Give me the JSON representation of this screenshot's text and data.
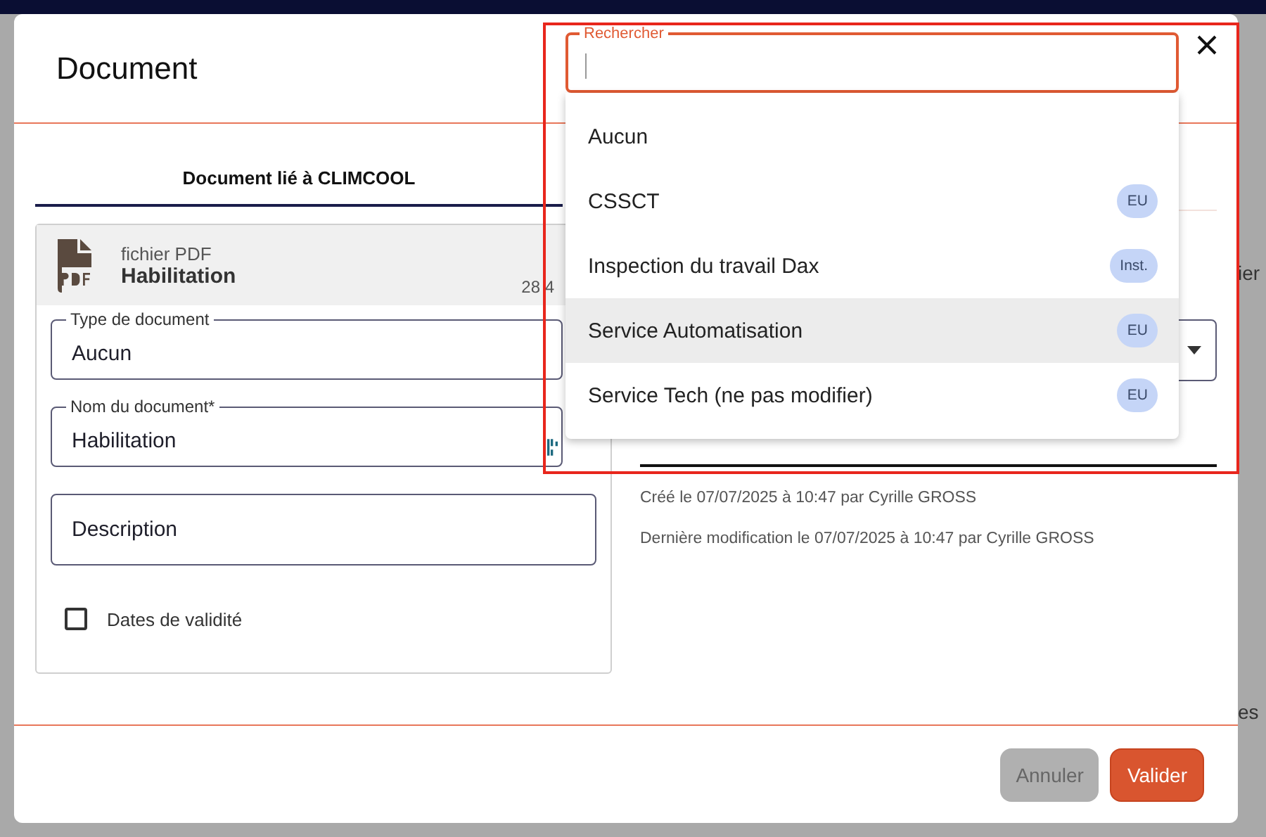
{
  "background_texts": [
    "ier",
    "es"
  ],
  "dialog": {
    "title": "Document",
    "tab": "Document lié à CLIMCOOL",
    "file": {
      "type": "fichier PDF",
      "name": "Habilitation",
      "size": "28 4"
    },
    "fields": [
      {
        "kind": "select",
        "label": "Type de document",
        "value": "Aucun"
      },
      {
        "kind": "text",
        "label": "Nom du document*",
        "value": "Habilitation"
      },
      {
        "kind": "textarea",
        "placeholder": "Description"
      }
    ],
    "validity_checkbox": {
      "label": "Dates de validité",
      "checked": false
    },
    "history": [
      "Créé le 07/07/2025 à 10:47 par Cyrille GROSS",
      "Dernière modification le 07/07/2025 à 10:47 par Cyrille GROSS"
    ],
    "buttons": [
      {
        "label": "Annuler",
        "disabled": true
      },
      {
        "label": "Valider",
        "disabled": false
      }
    ]
  },
  "dropdown": {
    "search_label": "Rechercher",
    "options": [
      {
        "label": "Aucun",
        "selected": false
      },
      {
        "label": "CSSCT",
        "badge": "EU",
        "selected": false
      },
      {
        "label": "Inspection du travail Dax",
        "badge": "Inst.",
        "selected": false
      },
      {
        "label": "Service Automatisation",
        "badge": "EU",
        "selected": true
      },
      {
        "label": "Service Tech (ne pas modifier)",
        "badge": "EU",
        "selected": false
      }
    ]
  }
}
